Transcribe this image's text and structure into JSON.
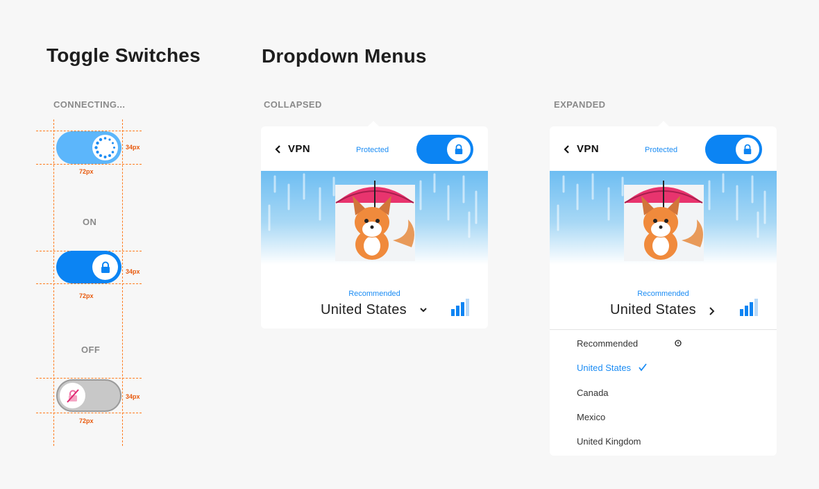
{
  "toggles": {
    "title": "Toggle Switches",
    "connecting_label": "CONNECTING...",
    "on_label": "ON",
    "off_label": "OFF",
    "height_dim": "34px",
    "width_dim": "72px"
  },
  "dropdowns": {
    "title": "Dropdown Menus",
    "collapsed_label": "COLLAPSED",
    "expanded_label": "EXPANDED"
  },
  "panel": {
    "back_icon": "chevron-left-icon",
    "title": "VPN",
    "status": "Protected",
    "recommended": "Recommended",
    "country": "United States"
  },
  "menu": {
    "items": [
      "Recommended",
      "United States",
      "Canada",
      "Mexico",
      "United Kingdom"
    ],
    "selected": "United States"
  },
  "colors": {
    "accent": "#0b84f3",
    "accent_light": "#5cb6fb",
    "text_blue": "#1b8cf4",
    "off_gray": "#c8c8c8",
    "dim_orange": "#e8590c"
  }
}
